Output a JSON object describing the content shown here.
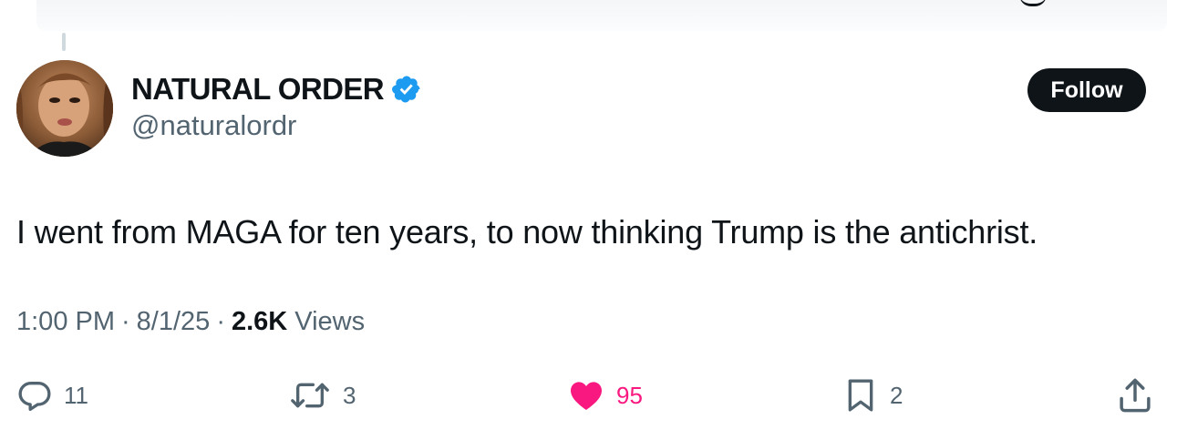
{
  "author": {
    "display_name": "NATURAL ORDER",
    "handle": "@naturalordr",
    "verified": true,
    "follow_label": "Follow"
  },
  "tweet": {
    "text": "I went from MAGA for ten years, to now thinking Trump is the antichrist.",
    "time": "1:00 PM",
    "date": "8/1/25",
    "separator": "·",
    "views_count": "2.6K",
    "views_label": "Views"
  },
  "actions": {
    "replies": "11",
    "reposts": "3",
    "likes": "95",
    "bookmarks": "2"
  },
  "colors": {
    "text": "#0f1419",
    "secondary": "#536471",
    "verified": "#1d9bf0",
    "like": "#f91880"
  }
}
